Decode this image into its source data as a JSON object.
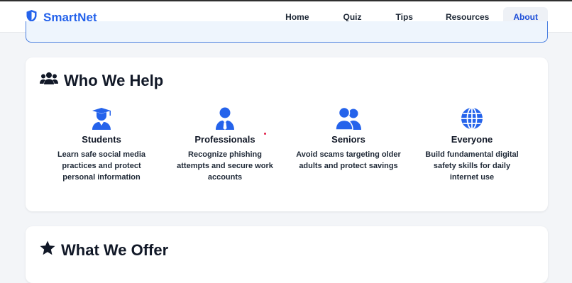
{
  "brand": {
    "name": "SmartNet",
    "icon": "shield-icon",
    "color": "#2563eb"
  },
  "nav": {
    "items": [
      {
        "label": "Home"
      },
      {
        "label": "Quiz"
      },
      {
        "label": "Tips"
      },
      {
        "label": "Resources"
      },
      {
        "label": "About",
        "active": true
      }
    ]
  },
  "who_we_help": {
    "title": "Who We Help",
    "icon": "users-icon",
    "audiences": [
      {
        "title": "Students",
        "icon": "graduate-icon",
        "description": "Learn safe social media practices and protect personal information"
      },
      {
        "title": "Professionals",
        "icon": "professional-icon",
        "description": "Recognize phishing attempts and secure work accounts"
      },
      {
        "title": "Seniors",
        "icon": "user-group-icon",
        "description": "Avoid scams targeting older adults and protect savings"
      },
      {
        "title": "Everyone",
        "icon": "globe-icon",
        "description": "Build fundamental digital safety skills for daily internet use"
      }
    ]
  },
  "what_we_offer": {
    "title": "What We Offer",
    "icon": "star-icon"
  },
  "colors": {
    "accent": "#2563eb",
    "active_nav_bg": "#eef1f6",
    "page_bg": "#f3f5f8"
  }
}
